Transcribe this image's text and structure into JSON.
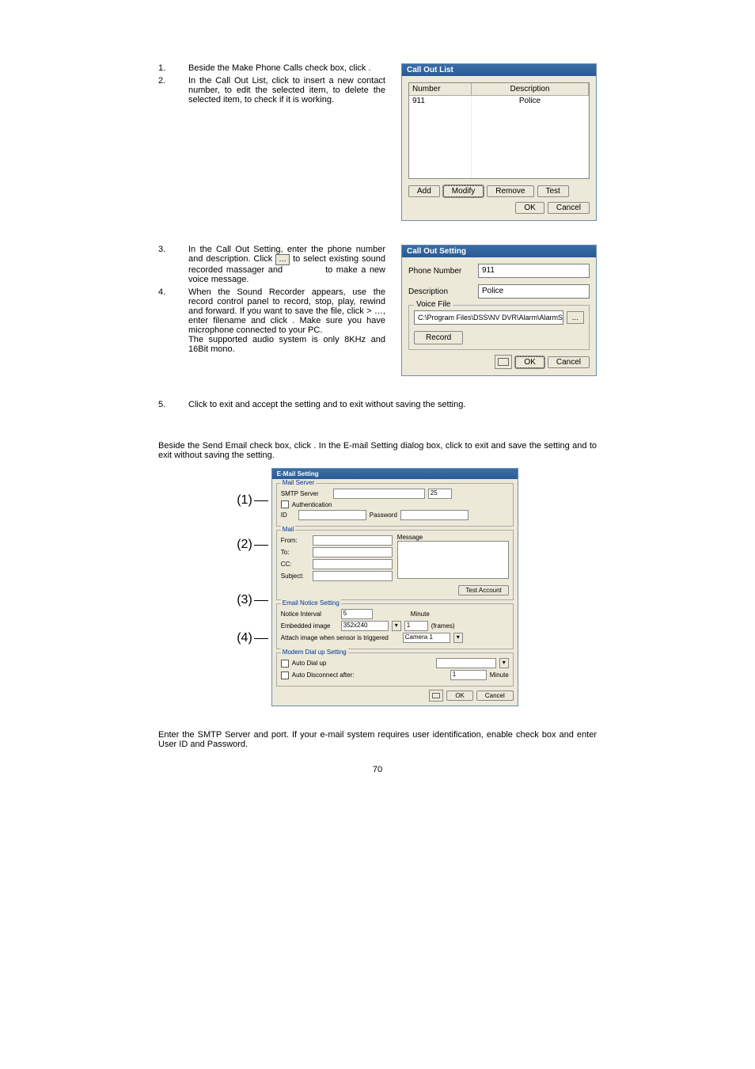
{
  "step1": {
    "num": "1.",
    "text": "Beside the Make Phone Calls check box, click        ."
  },
  "step2": {
    "num": "2.",
    "text": "In the Call Out List, click        to insert a new contact number,        to edit the selected item,        to delete the selected item,        to check if it is working."
  },
  "step3": {
    "num": "3.",
    "text": "In the Call Out Setting, enter the phone number and description. Click        to select existing sound recorded massager and            to make a new voice message."
  },
  "step4": {
    "num": "4.",
    "text": "When the Sound Recorder appears, use the record control panel to record, stop, play, rewind and forward. If you want to save the file, click        >          …, enter filename and click        . Make sure you have microphone connected to your PC.\nThe supported audio system is only 8KHz and 16Bit mono."
  },
  "step5": {
    "num": "5.",
    "text": "Click        to exit and accept the setting and            to exit without saving the setting."
  },
  "calloutlist": {
    "title": "Call Out List",
    "col_number": "Number",
    "col_desc": "Description",
    "row_num": "911",
    "row_desc": "Police",
    "btn_add": "Add",
    "btn_modify": "Modify",
    "btn_remove": "Remove",
    "btn_test": "Test",
    "btn_ok": "OK",
    "btn_cancel": "Cancel"
  },
  "calloutsetting": {
    "title": "Call Out Setting",
    "lbl_phone": "Phone Number",
    "val_phone": "911",
    "lbl_desc": "Description",
    "val_desc": "Police",
    "grp_voice": "Voice File",
    "val_path": "C:\\Program Files\\DSS\\NV DVR\\Alarm\\AlarmS",
    "btn_browse": "...",
    "btn_record": "Record",
    "btn_ok": "OK",
    "btn_cancel": "Cancel"
  },
  "email_para": "Beside the Send Email check box, click        . In the E-mail Setting dialog box, click        to exit and save the setting and            to exit without saving the setting.",
  "email_dlg": {
    "title": "E-Mail Setting",
    "grp_mailserver": "Mail Server",
    "lbl_smtp": "SMTP Server",
    "val_port": "25",
    "lbl_auth": "Authentication",
    "lbl_id": "ID",
    "lbl_pwd": "Password",
    "grp_mail": "Mail",
    "lbl_from": "From:",
    "lbl_to": "To:",
    "lbl_cc": "CC:",
    "lbl_subject": "Subject:",
    "lbl_message": "Message",
    "btn_test": "Test Account",
    "grp_notice": "Email Notice Setting",
    "lbl_interval": "Notice Interval",
    "val_interval": "5",
    "lbl_minute": "Minute",
    "lbl_embed": "Embedded image",
    "val_embed": "352x240",
    "val_frames_n": "1",
    "lbl_frames": "(frames)",
    "lbl_attach": "Attach image when sensor is triggered",
    "val_camera": "Camera 1",
    "grp_modem": "Modem Dial up Setting",
    "lbl_autodial": "Auto Dial up",
    "lbl_autodisc": "Auto Disconnect after:",
    "val_disc": "1",
    "lbl_disc_min": "Minute",
    "btn_ok": "OK",
    "btn_cancel": "Cancel"
  },
  "callouts": {
    "n1": "(1)",
    "n2": "(2)",
    "n3": "(3)",
    "n4": "(4)"
  },
  "bottom_para": "Enter the SMTP Server and port. If your e-mail system requires user identification, enable             check box and enter User ID and Password.",
  "page_number": "70"
}
